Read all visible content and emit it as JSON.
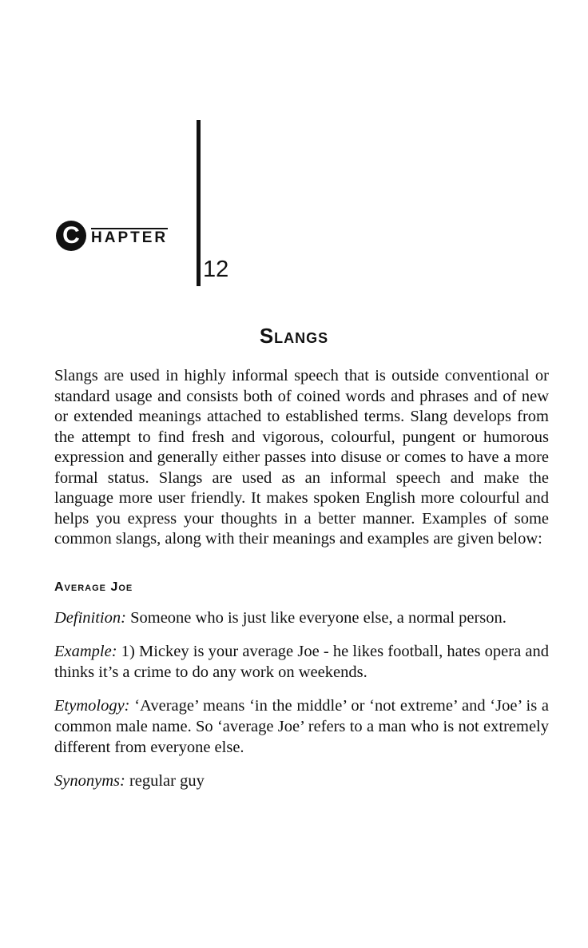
{
  "chapter": {
    "letter": "C",
    "word": "HAPTER",
    "number": "12"
  },
  "title": "Slangs",
  "intro": "Slangs are used in highly informal speech that is outside conventional or standard usage and consists both of coined words and phrases and of new or extended meanings attached to established terms. Slang develops from the attempt to find fresh and vigorous, colourful, pungent or humorous expression and generally either passes into disuse or comes to have a more formal status. Slangs are used as an informal speech and make the language more user friendly. It makes spoken English more colourful and helps you express your thoughts in a better manner. Examples of some common slangs, along with their meanings and examples are given below:",
  "entry": {
    "heading": "Average Joe",
    "definition_label": "Definition:",
    "definition": "Someone who is just like everyone else, a normal person.",
    "example_label": "Example:",
    "example": "1) Mickey is your average Joe - he likes football, hates opera and thinks it’s a crime to do any work on weekends.",
    "etymology_label": "Etymology:",
    "etymology": "‘Average’ means ‘in the middle’ or ‘not extreme’ and ‘Joe’ is a common male name. So ‘average Joe’ refers to a man who is not extremely different from everyone else.",
    "synonyms_label": "Synonyms:",
    "synonyms": "regular guy"
  }
}
